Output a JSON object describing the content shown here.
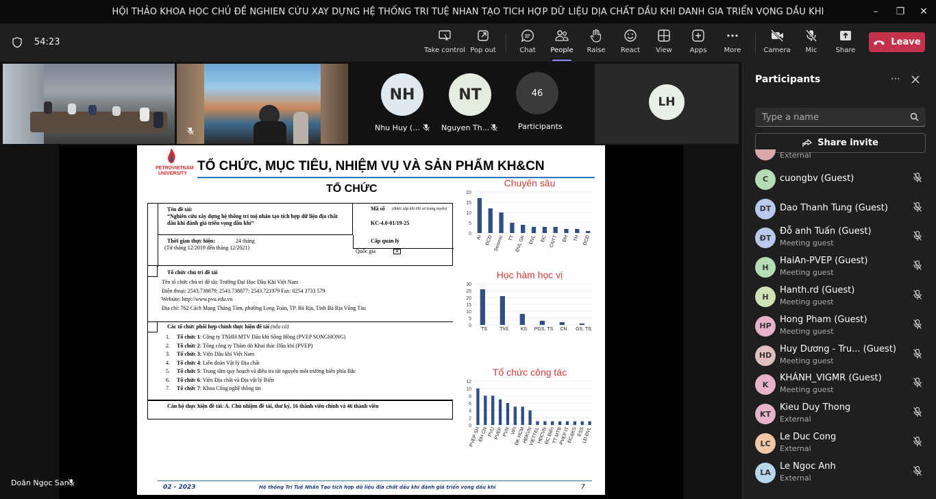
{
  "window": {
    "title": "HỘI THẢO KHOA HỌC CHỦ ĐỀ NGHIEN CỨU XAY DỰNG HỆ THỐNG TRI TUỆ NHAN TẠO TICH HỢP DỮ LIỆU DỊA CHẤT DẦU KHI DANH GIA TRIỂN VỌNG DẦU KHI"
  },
  "toolbar": {
    "timer": "54:23",
    "buttons": [
      "Take control",
      "Pop out",
      "Chat",
      "People",
      "Raise",
      "React",
      "View",
      "Apps",
      "More",
      "Camera",
      "Mic",
      "Share"
    ],
    "leave": "Leave"
  },
  "stage": {
    "tiles": [
      {
        "initials": "NH",
        "name": "Nhu Huy (..."
      },
      {
        "initials": "NT",
        "name": "Nguyen Th..."
      },
      {
        "initials": "46",
        "name": "Participants"
      },
      {
        "initials": "LH",
        "name": ""
      }
    ],
    "self_name": "Doãn Ngọc San"
  },
  "slide": {
    "logo_line1": "PETROVIETNAM",
    "logo_line2": "UNIVERSITY",
    "heading": "TỔ CHỨC, MỤC TIÊU, NHIỆM VỤ VÀ SẢN PHẨM KH&CN",
    "subheading": "TỔ CHỨC",
    "project_label": "Tên đề tài:",
    "project_name": "“Nghiên cứu xây dựng hệ thống trí tuệ nhân tạo tích hợp dữ liệu địa chất dầu khí đánh giá triển vọng dầu khí”",
    "code_label": "Mã số",
    "code_note": "(được cấp khi Hồ sơ trúng tuyển)",
    "code": "KC-4.0-01/19-25",
    "time_label": "Thời gian thực hiện:",
    "time_value": "24 tháng",
    "time_range": "(Từ tháng   12/2019 đến tháng 12/2021)",
    "level_label": "Cấp quản lý",
    "level_value": "Quốc gia",
    "host_title": "Tổ chức chủ trì đề tài",
    "host_lines": [
      "Tên tổ chức chủ trì đề tài: Trường Đại Học Dầu Khí Việt Nam",
      "Điện thoại: 2543.738879; 2543.738877; 2543.721979 Fax: 0254 3733 579",
      "Website: http://www.pvu.edu.vn",
      "Địa chỉ: 762 Cách Mạng Tháng Tám, phường Long Toàn, TP. Bà Rịa, Tỉnh Bà Rịa Vũng Tàu"
    ],
    "partners_title": "Các tổ chức phối hợp chính thực hiện đề tài",
    "partners_note": "(nếu có)",
    "partners": [
      {
        "n": "1.",
        "label": "Tổ chức 1",
        "text": ": Công ty TNHH MTV Dầu khí Sông Hồng (PVEP SONGHONG)"
      },
      {
        "n": "2.",
        "label": "Tổ chức 2",
        "text": ": Tổng công ty Thăm dò Khai thác Dầu khí (PVEP)"
      },
      {
        "n": "3.",
        "label": "Tổ chức 3",
        "text": ": Viện Dầu khí Việt Nam"
      },
      {
        "n": "4.",
        "label": "Tổ chức 4",
        "text": ": Liên đoàn Vật lý Địa chất"
      },
      {
        "n": "5.",
        "label": "Tổ chức 5",
        "text": ": Trung tâm quy hoạch và điều tra tài nguyên môi trường biển phía Bắc"
      },
      {
        "n": "6.",
        "label": "Tổ chức 6",
        "text": ": Viện Địa chất và Địa vật lý Biển"
      },
      {
        "n": "7.",
        "label": "Tổ chức 7",
        "text": ": Khoa Công nghệ thông tin"
      }
    ],
    "staff": "Cán bộ thực hiện đề tài: A. Chủ nhiệm đề tài, thư ký, 16 thành viên chính và 46 thành viên",
    "footer_left": "02 - 2023",
    "footer_mid": "Hệ thống Trí Tuệ Nhân Tạo tích hợp dữ liệu địa chất dầu khí  đánh giá triển vọng dầu khí",
    "footer_page": "7"
  },
  "chart_data": [
    {
      "type": "bar",
      "title": "Chuyên sâu",
      "categories": [
        "AI",
        "ĐCD",
        "Seismic",
        "TT",
        "ĐVL GK",
        "ĐVL",
        "ĐC",
        "CNTT",
        "ĐH",
        "TH",
        "ĐCĐ"
      ],
      "values": [
        17,
        12,
        10,
        5,
        4,
        3,
        3,
        3,
        2,
        2,
        1
      ],
      "ylim": [
        0,
        20
      ],
      "yticks": [
        0,
        5,
        10,
        15,
        20
      ]
    },
    {
      "type": "bar",
      "title": "Học hàm học vị",
      "categories": [
        "TS",
        "ThS",
        "KS",
        "PGS. TS",
        "CN",
        "GS. TS"
      ],
      "values": [
        26,
        21,
        8,
        3,
        2,
        1
      ],
      "ylim": [
        0,
        30
      ],
      "yticks": [
        0,
        5,
        10,
        15,
        20,
        25,
        30
      ]
    },
    {
      "type": "bar",
      "title": "Tổ chức công tác",
      "categories": [
        "PVEP SH",
        "ĐH CN",
        "PVU",
        "PVEP",
        "PVN",
        "VPI",
        "ĐK HCM",
        "HĐKVN",
        "VIETTEL",
        "HĐCVN",
        "ĐC Biển",
        "TT MTB",
        "PVEP IT",
        "ĐC&KS",
        "ESS",
        "LĐ ĐVL"
      ],
      "values": [
        10,
        8,
        8,
        7,
        6,
        5,
        5,
        4,
        1,
        1,
        1,
        1,
        1,
        1,
        1,
        1
      ],
      "ylim": [
        0,
        12
      ],
      "yticks": [
        0,
        2,
        4,
        6,
        8,
        10,
        12
      ]
    }
  ],
  "panel": {
    "title": "Participants",
    "search_placeholder": "Type a name",
    "invite": "Share invite",
    "participants": [
      {
        "initials": "",
        "name": "",
        "sub": "External",
        "color": "#d9a9a9"
      },
      {
        "initials": "C",
        "name": "cuongbv (Guest)",
        "sub": "",
        "color": "#b6dcb5"
      },
      {
        "initials": "DT",
        "name": "Dao Thanh Tung (Guest)",
        "sub": "",
        "color": "#b8c9ec"
      },
      {
        "initials": "ĐT",
        "name": "Đỗ anh Tuấn (Guest)",
        "sub": "Meeting guest",
        "color": "#b8c9ec"
      },
      {
        "initials": "H",
        "name": "HaiAn-PVEP (Guest)",
        "sub": "Meeting guest",
        "color": "#b6dcb5"
      },
      {
        "initials": "H",
        "name": "Hanth.rd (Guest)",
        "sub": "Meeting guest",
        "color": "#cfe3b7"
      },
      {
        "initials": "HP",
        "name": "Hong Pham (Guest)",
        "sub": "Meeting guest",
        "color": "#e7b3c9"
      },
      {
        "initials": "HD",
        "name": "Huy Dương - Tru... (Guest)",
        "sub": "Meeting guest",
        "color": "#e3c0c0"
      },
      {
        "initials": "K",
        "name": "KHÁNH_VIGMR (Guest)",
        "sub": "Meeting guest",
        "color": "#e7b3c9"
      },
      {
        "initials": "KT",
        "name": "Kieu Duy Thong",
        "sub": "External",
        "color": "#e7b3c9"
      },
      {
        "initials": "LC",
        "name": "Le Duc Cong",
        "sub": "External",
        "color": "#f0c8a8"
      },
      {
        "initials": "LA",
        "name": "Le Ngoc Anh",
        "sub": "External",
        "color": "#b8d6ec"
      }
    ]
  },
  "colors": {
    "leave": "#c4314b",
    "accent": "#8b8cf0",
    "bar": "#2f4f87",
    "slide_title": "#d33a3a"
  }
}
